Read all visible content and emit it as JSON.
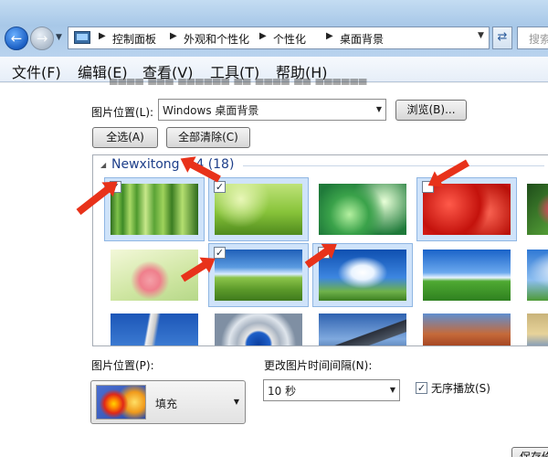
{
  "address": {
    "breadcrumbs": [
      "控制面板",
      "外观和个性化",
      "个性化",
      "桌面背景"
    ],
    "search_placeholder": "搜索"
  },
  "menu": [
    "文件(F)",
    "编辑(E)",
    "查看(V)",
    "工具(T)",
    "帮助(H)"
  ],
  "picture_location": {
    "label": "图片位置(L):",
    "value": "Windows 桌面背景",
    "browse_label": "浏览(B)..."
  },
  "select_all_label": "全选(A)",
  "clear_all_label": "全部清除(C)",
  "group": {
    "title": "Newxitong 6.4 (18)",
    "thumbnails": [
      {
        "name": "bamboo",
        "checked": true
      },
      {
        "name": "grass-dew",
        "checked": true
      },
      {
        "name": "green-bokeh",
        "checked": false
      },
      {
        "name": "strawberries",
        "checked": false
      },
      {
        "name": "green-leaves",
        "checked": false
      },
      {
        "name": "pink-flower",
        "checked": false
      },
      {
        "name": "meadow-sky",
        "checked": true
      },
      {
        "name": "blue-sky-clouds",
        "checked": true
      },
      {
        "name": "field-horizon",
        "checked": false
      },
      {
        "name": "clouds-hills",
        "checked": false
      },
      {
        "name": "tower",
        "checked": false
      },
      {
        "name": "architecture-circle",
        "checked": false
      },
      {
        "name": "mountain-lake",
        "checked": false
      },
      {
        "name": "red-rocks",
        "checked": false
      },
      {
        "name": "sea-rock",
        "checked": false
      }
    ]
  },
  "picture_position": {
    "label": "图片位置(P):",
    "value": "填充"
  },
  "interval": {
    "label": "更改图片时间间隔(N):",
    "value": "10 秒"
  },
  "shuffle": {
    "label": "无序播放(S)",
    "checked": true
  },
  "save_label": "保存修改"
}
